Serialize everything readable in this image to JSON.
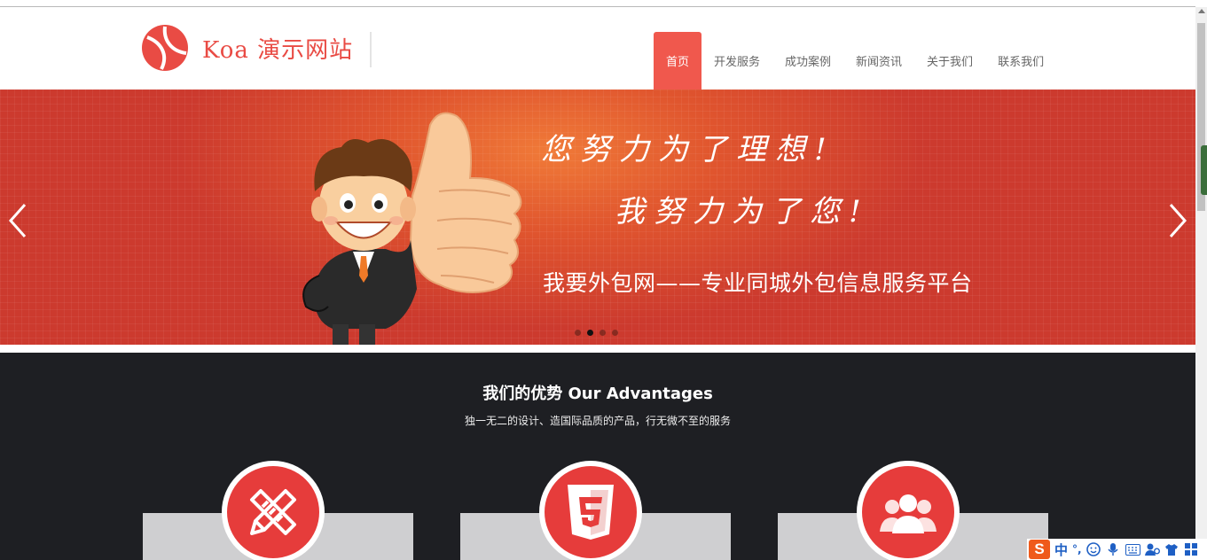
{
  "header": {
    "logo_text": "Koa 演示网站",
    "nav": [
      {
        "label": "首页",
        "active": true
      },
      {
        "label": "开发服务",
        "active": false
      },
      {
        "label": "成功案例",
        "active": false
      },
      {
        "label": "新闻资讯",
        "active": false
      },
      {
        "label": "关于我们",
        "active": false
      },
      {
        "label": "联系我们",
        "active": false
      }
    ]
  },
  "banner": {
    "slogan_line1": "您努力为了理想!",
    "slogan_line2": "我努力为了您!",
    "slogan_line3": "我要外包网——专业同城外包信息服务平台",
    "slide_count": 4,
    "active_slide": 2,
    "prev_icon": "chevron-left-icon",
    "next_icon": "chevron-right-icon"
  },
  "advantages": {
    "title": "我们的优势 Our Advantages",
    "subtitle": "独一无二的设计、造国际品质的产品，行无微不至的服务",
    "items": [
      {
        "icon": "pencil-ruler-icon"
      },
      {
        "icon": "html5-icon"
      },
      {
        "icon": "users-icon"
      }
    ]
  },
  "ime": {
    "logo": "S",
    "mode": "中",
    "punct": "°,"
  },
  "colors": {
    "brand": "#e94b44",
    "nav_active": "#f0584d",
    "dark_section": "#1e1f23",
    "card": "#cfcfd1",
    "icon_red": "#e63c3b"
  }
}
